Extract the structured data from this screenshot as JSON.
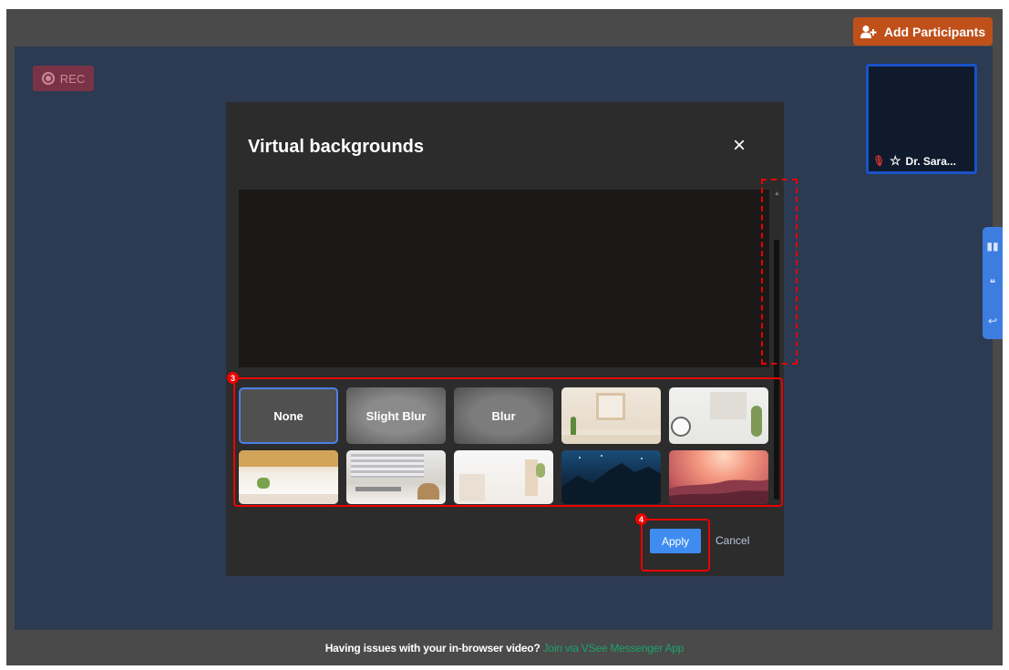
{
  "topbar": {
    "add_participants_label": "Add Participants"
  },
  "stage": {
    "rec_label": "REC",
    "participant_name": "Dr. Sara..."
  },
  "modal": {
    "title": "Virtual backgrounds",
    "close_label": "×",
    "backgrounds": [
      {
        "label": "None",
        "kind": "none",
        "selected": true
      },
      {
        "label": "Slight Blur",
        "kind": "slight"
      },
      {
        "label": "Blur",
        "kind": "blur"
      },
      {
        "label": "",
        "kind": "room1"
      },
      {
        "label": "",
        "kind": "room2"
      },
      {
        "label": "",
        "kind": "room3"
      },
      {
        "label": "",
        "kind": "room4"
      },
      {
        "label": "",
        "kind": "room5"
      },
      {
        "label": "",
        "kind": "night"
      },
      {
        "label": "",
        "kind": "sunset"
      }
    ],
    "apply_label": "Apply",
    "cancel_label": "Cancel"
  },
  "annotations": {
    "badge_3": "3",
    "badge_4": "4"
  },
  "footer": {
    "message": "Having issues with your in-browser video?",
    "link_label": "Join via VSee Messenger App"
  },
  "colors": {
    "accent_orange": "#c0501a",
    "apply_blue": "#3f8cf0",
    "link_green": "#1aa36b",
    "stage_bg": "#2c3a52"
  },
  "icons": [
    "add-user-icon",
    "record-icon",
    "mic-off-icon",
    "star-icon",
    "close-icon",
    "book-icon",
    "thumbs-icon",
    "reply-icon"
  ]
}
